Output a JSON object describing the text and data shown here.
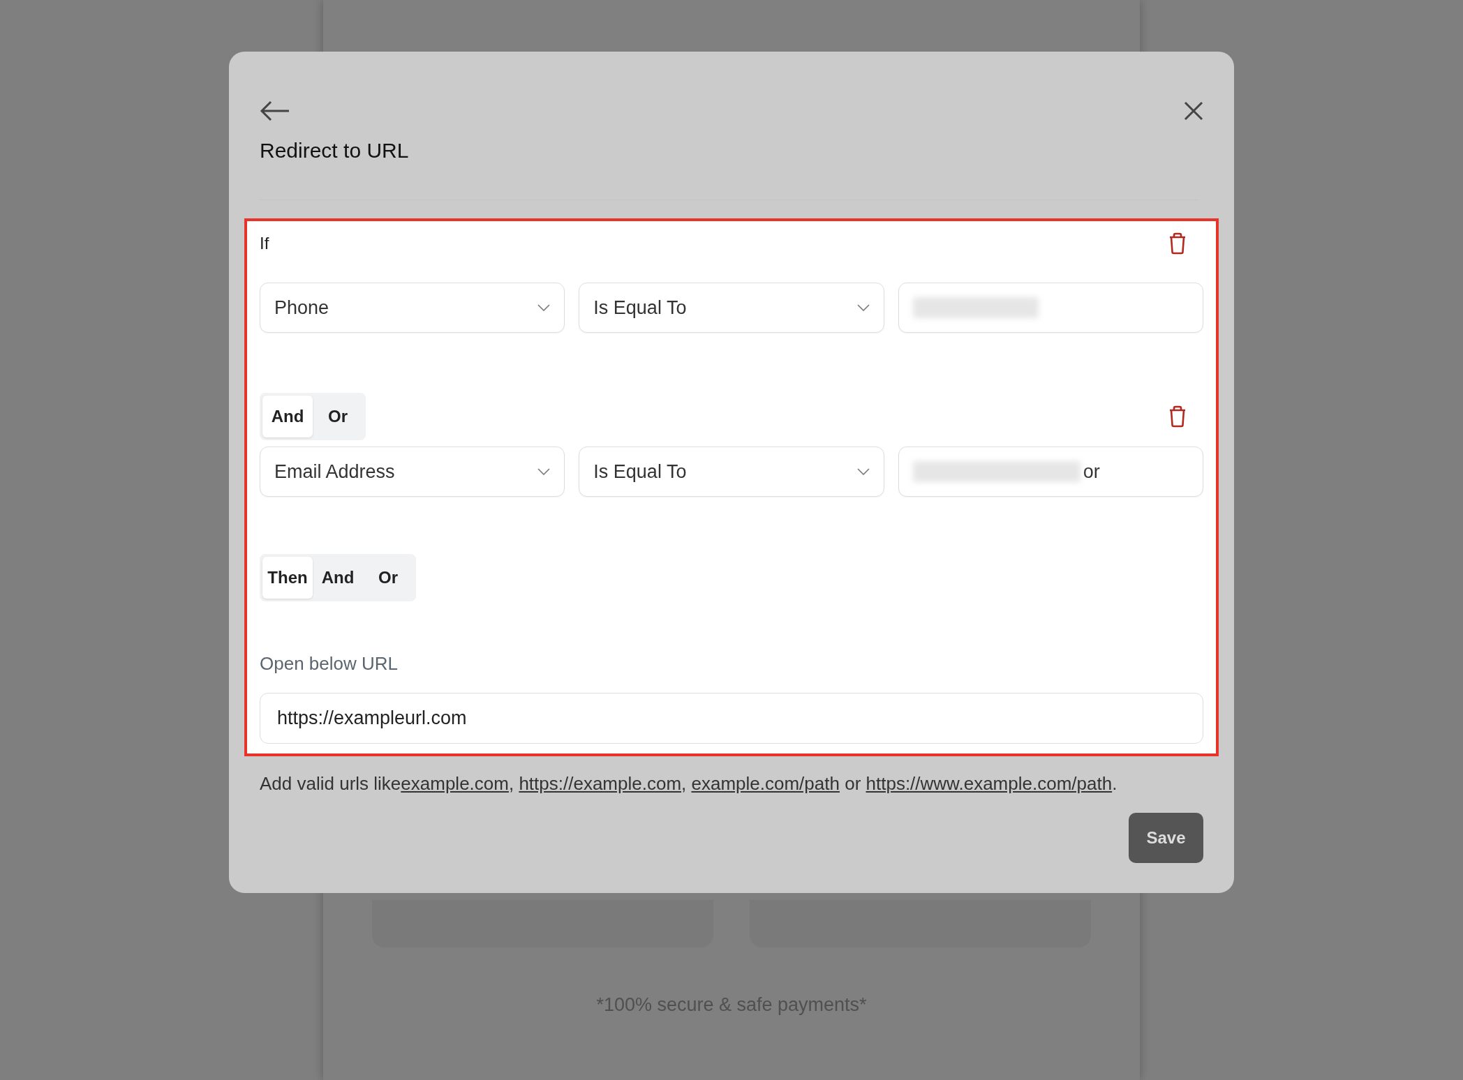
{
  "background": {
    "footnote": "*100% secure & safe payments*"
  },
  "dialog": {
    "title": "Redirect to URL",
    "highlighted": true,
    "rule": {
      "label": "If",
      "conditions": [
        {
          "field": "Phone",
          "operator": "Is Equal To",
          "redacted": true
        },
        {
          "connector_options": [
            {
              "label": "And",
              "selected": true
            },
            {
              "label": "Or",
              "selected": false
            }
          ],
          "field": "Email Address",
          "operator": "Is Equal To",
          "redacted": true,
          "value_tail": "or"
        }
      ],
      "action_options": [
        {
          "label": "Then",
          "selected": true
        },
        {
          "label": "And",
          "selected": false
        },
        {
          "label": "Or",
          "selected": false
        }
      ],
      "action_label": "Open below URL",
      "url": "https://exampleurl.com"
    },
    "helper": [
      {
        "kind": "text",
        "text": "Add valid urls like"
      },
      {
        "kind": "link",
        "text": "example.com"
      },
      {
        "kind": "text",
        "text": ", "
      },
      {
        "kind": "link",
        "text": "https://example.com"
      },
      {
        "kind": "text",
        "text": ", "
      },
      {
        "kind": "link",
        "text": "example.com/path"
      },
      {
        "kind": "text",
        "text": " or "
      },
      {
        "kind": "link",
        "text": "https://www.example.com/path"
      },
      {
        "kind": "text",
        "text": "."
      }
    ],
    "save": "Save"
  }
}
